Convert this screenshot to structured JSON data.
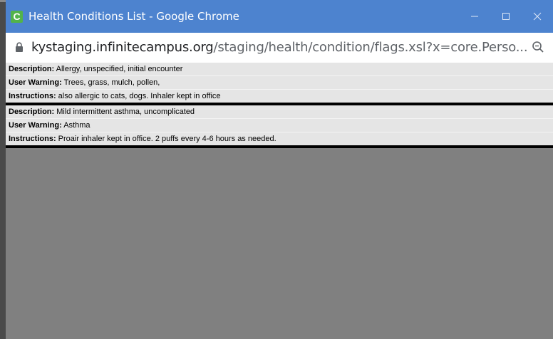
{
  "window": {
    "app_icon_letter": "C",
    "title": "Health Conditions List - Google Chrome",
    "colors": {
      "titlebar": "#4d83cf",
      "app_icon": "#52b34a",
      "content_bg": "#808080",
      "record_bg": "#e5e5e5"
    }
  },
  "address_bar": {
    "host": "kystaging.infinitecampus.org",
    "path": "/staging/health/condition/flags.xsl?x=core.Perso..."
  },
  "records": [
    {
      "description_label": "Description:",
      "description": " Allergy, unspecified, initial encounter",
      "warning_label": "User Warning:",
      "warning": " Trees, grass, mulch, pollen,",
      "instructions_label": "Instructions:",
      "instructions": " also allergic to cats, dogs. Inhaler kept in office"
    },
    {
      "description_label": "Description:",
      "description": " Mild intermittent asthma, uncomplicated",
      "warning_label": "User Warning:",
      "warning": " Asthma",
      "instructions_label": "Instructions:",
      "instructions": " Proair inhaler kept in office. 2 puffs every 4-6 hours as needed."
    }
  ]
}
